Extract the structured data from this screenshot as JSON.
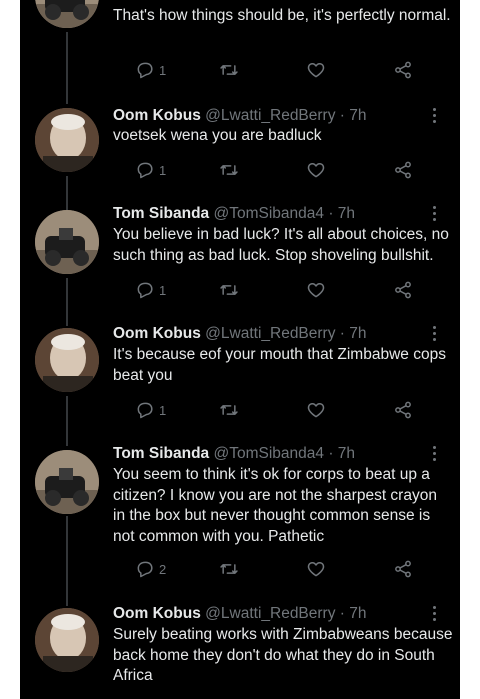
{
  "thread": {
    "tweets": [
      {
        "name": "",
        "handle": "",
        "time": "",
        "text": "That's how things should be, it's perfectly normal.",
        "reply_count": "1",
        "avatar": "tom-sibanda-avatar"
      },
      {
        "name": "Oom Kobus",
        "handle": "@Lwatti_RedBerry",
        "time": "· 7h",
        "text": "voetsek wena you are badluck",
        "reply_count": "1",
        "avatar": "oom-kobus-avatar"
      },
      {
        "name": "Tom Sibanda",
        "handle": "@TomSibanda4",
        "time": "· 7h",
        "text": "You believe in bad luck? It's all about choices, no such thing as bad luck. Stop shoveling bullshit.",
        "reply_count": "1",
        "avatar": "tom-sibanda-avatar"
      },
      {
        "name": "Oom Kobus",
        "handle": "@Lwatti_RedBerry",
        "time": "· 7h",
        "text": "It's because eof your mouth that Zimbabwe cops beat you",
        "reply_count": "1",
        "avatar": "oom-kobus-avatar"
      },
      {
        "name": "Tom Sibanda",
        "handle": "@TomSibanda4",
        "time": "· 7h",
        "text": "You seem to think it's ok for corps to beat up a citizen? I know you are not the sharpest crayon in the box but never thought common sense is not common with you. Pathetic",
        "reply_count": "2",
        "avatar": "tom-sibanda-avatar"
      },
      {
        "name": "Oom Kobus",
        "handle": "@Lwatti_RedBerry",
        "time": "· 7h",
        "text": "Surely beating works with Zimbabweans because back home they don't do what they do in South Africa",
        "reply_count": "",
        "avatar": "oom-kobus-avatar"
      }
    ]
  },
  "icons": {
    "reply": "reply-icon",
    "retweet": "retweet-icon",
    "like": "heart-icon",
    "share": "share-icon",
    "more": "more-options-icon"
  },
  "colors": {
    "background": "#000000",
    "text": "#e7e9ea",
    "secondary": "#71767b",
    "thread_line": "#333639"
  }
}
